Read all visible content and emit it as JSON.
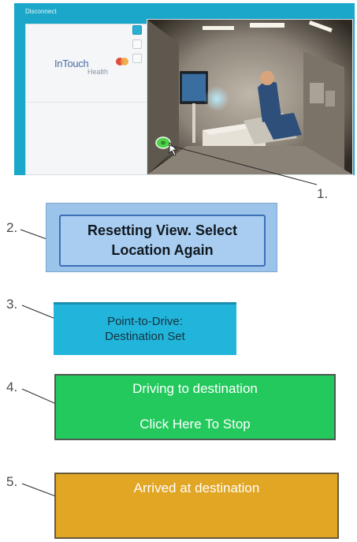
{
  "app": {
    "title": "Disconnect",
    "logo_text": "InTouch",
    "logo_sub": "Health"
  },
  "labels": {
    "one": "1.",
    "two": "2.",
    "three": "3.",
    "four": "4.",
    "five": "5."
  },
  "banners": {
    "resetting_line1": "Resetting View. Select",
    "resetting_line2": "Location Again",
    "destination_line1": "Point-to-Drive:",
    "destination_line2": "Destination Set",
    "driving_line1": "Driving to destination",
    "driving_line2": "Click Here To Stop",
    "arrived": "Arrived at destination"
  },
  "colors": {
    "app_bar": "#1ba7c9",
    "resetting": "#9cc3ea",
    "destination": "#22b5dc",
    "driving": "#23c95d",
    "arrived": "#e2a625"
  }
}
